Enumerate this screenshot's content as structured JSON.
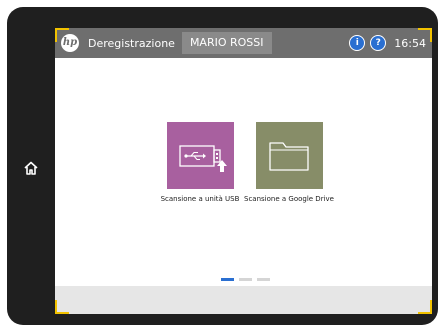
{
  "header": {
    "logo_icon": "hp-logo",
    "logout_label": "Deregistrazione",
    "user_name": "MARIO ROSSI",
    "info_icon": "info-icon",
    "help_icon": "help-icon",
    "time": "16:54"
  },
  "sidebar": {
    "home_icon": "home-icon"
  },
  "tiles": [
    {
      "label": "Scansione a unità USB",
      "icon": "usb-scan-icon",
      "color": "#a8609f"
    },
    {
      "label": "Scansione a Google Drive",
      "icon": "folder-icon",
      "color": "#878d68"
    }
  ],
  "pager": {
    "total": 3,
    "active": 1
  },
  "colors": {
    "header_bg": "#6e6e6e",
    "accent": "#2a6fd1",
    "focus_corner": "#f2c200"
  }
}
